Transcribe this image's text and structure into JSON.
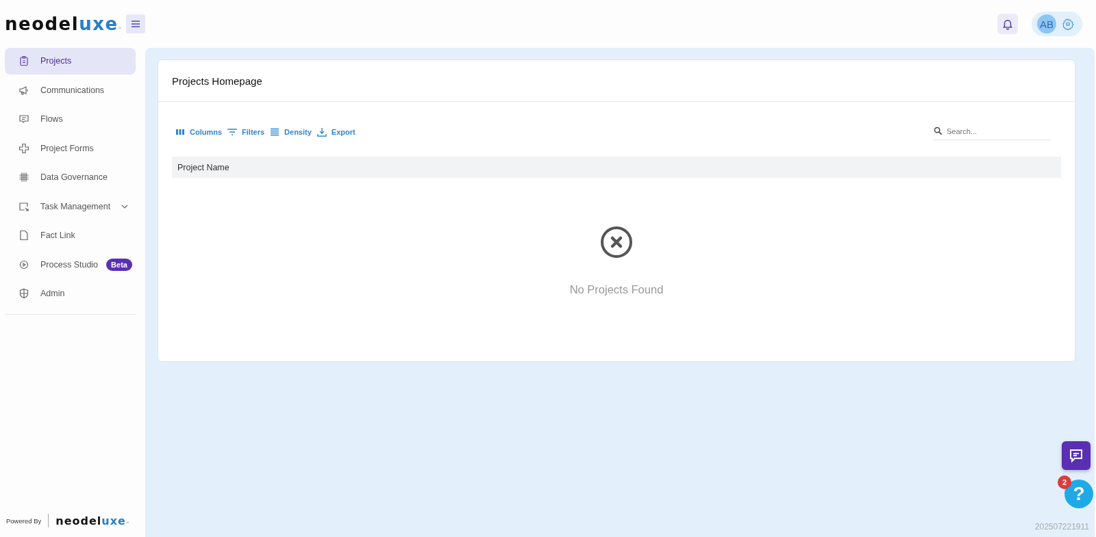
{
  "header": {
    "logo": {
      "main": "neodel",
      "accent": "uxe",
      "mark": "™"
    },
    "avatar": "AB"
  },
  "sidebar": {
    "items": [
      {
        "label": "Projects",
        "selected": true,
        "expandable": false
      },
      {
        "label": "Communications",
        "selected": false,
        "expandable": false
      },
      {
        "label": "Flows",
        "selected": false,
        "expandable": false
      },
      {
        "label": "Project Forms",
        "selected": false,
        "expandable": false
      },
      {
        "label": "Data Governance",
        "selected": false,
        "expandable": false
      },
      {
        "label": "Task Management",
        "selected": false,
        "expandable": true
      },
      {
        "label": "Fact Link",
        "selected": false,
        "expandable": false
      },
      {
        "label": "Process Studio",
        "selected": false,
        "expandable": false,
        "badge": "Beta"
      },
      {
        "label": "Admin",
        "selected": false,
        "expandable": false
      }
    ],
    "footer": {
      "label": "Powered By",
      "logo": {
        "main": "neodel",
        "accent": "uxe",
        "mark": "™"
      }
    }
  },
  "page": {
    "title": "Projects Homepage",
    "toolbar": [
      {
        "label": "Columns"
      },
      {
        "label": "Filters"
      },
      {
        "label": "Density"
      },
      {
        "label": "Export"
      }
    ],
    "search": {
      "placeholder": "Search..."
    },
    "table": {
      "columns": [
        "Project Name"
      ]
    },
    "empty_message": "No Projects Found"
  },
  "help": {
    "badge": "2",
    "label": "?"
  },
  "build": "202507221911"
}
